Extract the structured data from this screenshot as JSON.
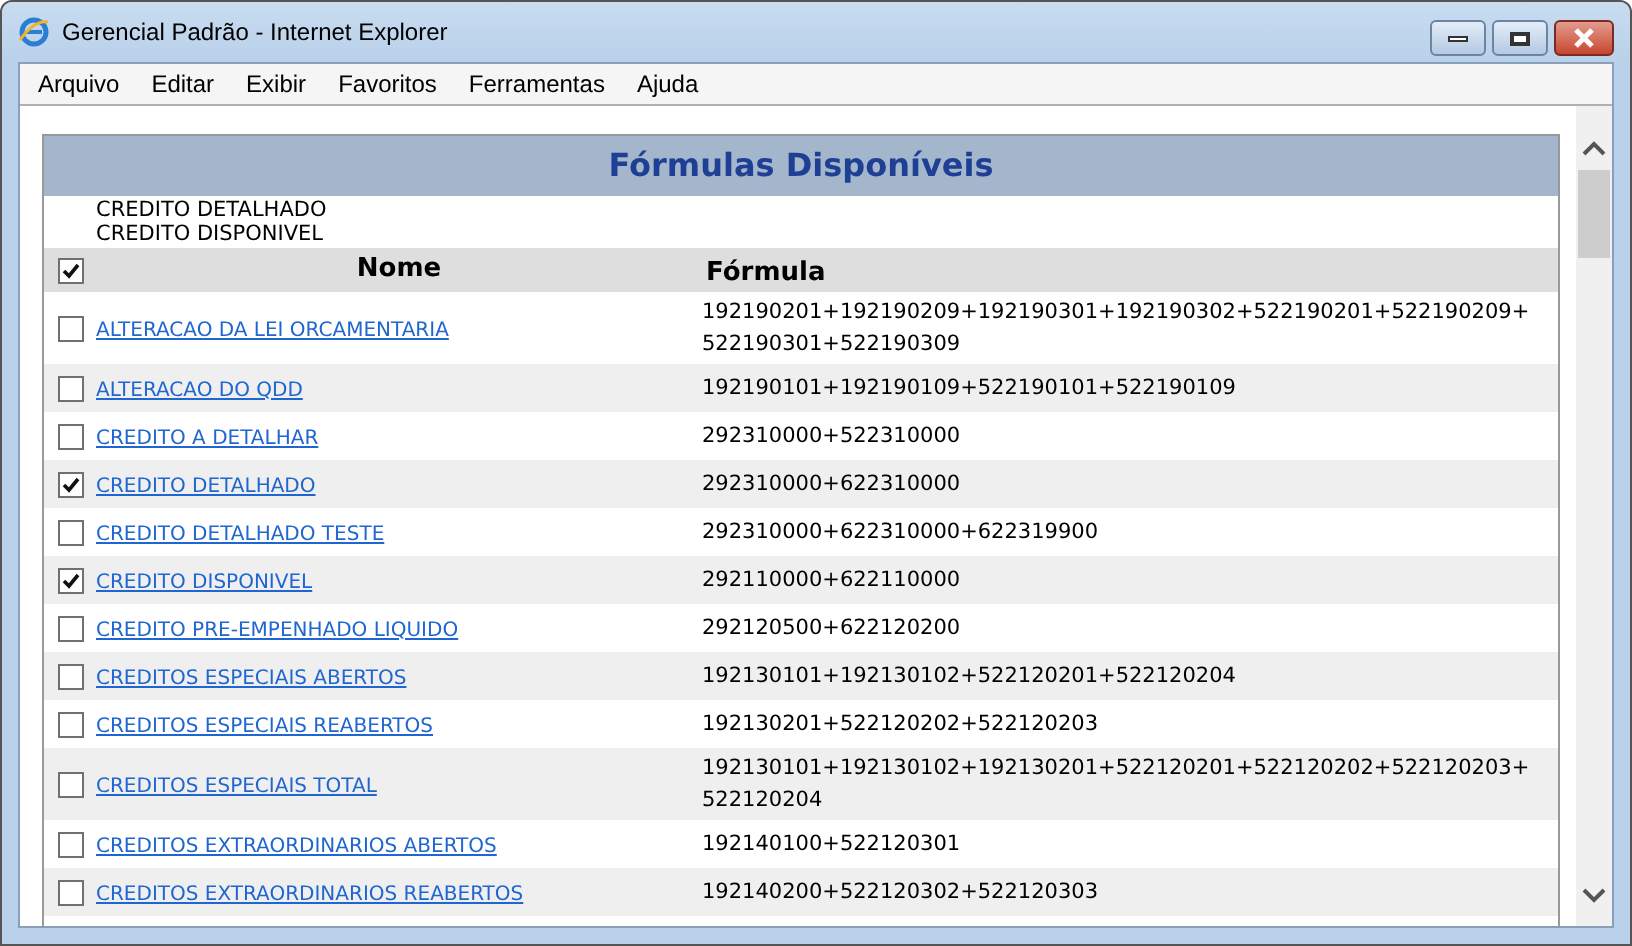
{
  "window": {
    "title": "Gerencial Padrão - Internet Explorer"
  },
  "menu": [
    "Arquivo",
    "Editar",
    "Exibir",
    "Favoritos",
    "Ferramentas",
    "Ajuda"
  ],
  "panel": {
    "title": "Fórmulas Disponíveis",
    "selected_items": [
      "CREDITO DETALHADO",
      "CREDITO DISPONIVEL"
    ]
  },
  "table": {
    "select_all_checked": true,
    "columns": [
      "Nome",
      "Fórmula"
    ],
    "rows": [
      {
        "name": "ALTERACAO DA LEI ORCAMENTARIA",
        "formula": "192190201+192190209+192190301+192190302+522190201+522190209+522190301+522190309",
        "checked": false
      },
      {
        "name": "ALTERACAO DO QDD",
        "formula": "192190101+192190109+522190101+522190109",
        "checked": false
      },
      {
        "name": "CREDITO A DETALHAR",
        "formula": "292310000+522310000",
        "checked": false
      },
      {
        "name": "CREDITO DETALHADO",
        "formula": "292310000+622310000",
        "checked": true
      },
      {
        "name": "CREDITO DETALHADO TESTE",
        "formula": "292310000+622310000+622319900",
        "checked": false
      },
      {
        "name": "CREDITO DISPONIVEL",
        "formula": "292110000+622110000",
        "checked": true
      },
      {
        "name": "CREDITO PRE-EMPENHADO LIQUIDO",
        "formula": "292120500+622120200",
        "checked": false
      },
      {
        "name": "CREDITOS ESPECIAIS ABERTOS",
        "formula": "192130101+192130102+522120201+522120204",
        "checked": false
      },
      {
        "name": "CREDITOS ESPECIAIS REABERTOS",
        "formula": "192130201+522120202+522120203",
        "checked": false
      },
      {
        "name": "CREDITOS ESPECIAIS TOTAL",
        "formula": "192130101+192130102+192130201+522120201+522120202+522120203+522120204",
        "checked": false
      },
      {
        "name": "CREDITOS EXTRAORDINARIOS ABERTOS",
        "formula": "192140100+522120301",
        "checked": false
      },
      {
        "name": "CREDITOS EXTRAORDINARIOS REABERTOS",
        "formula": "192140200+522120302+522120303",
        "checked": false
      }
    ]
  }
}
